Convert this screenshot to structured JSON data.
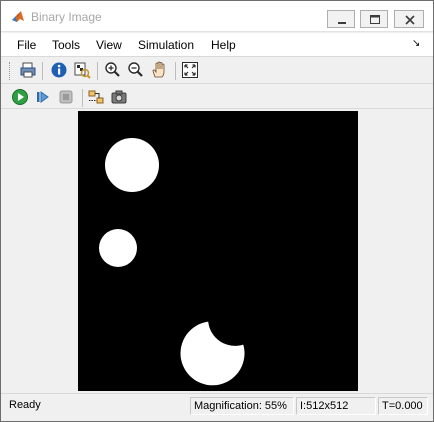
{
  "window": {
    "title": "Binary Image",
    "controls": {
      "minimize": "minimize",
      "maximize": "maximize",
      "close": "close"
    }
  },
  "menu": {
    "items": [
      "File",
      "Tools",
      "View",
      "Simulation",
      "Help"
    ]
  },
  "toolbar1": {
    "icons": [
      "print-icon",
      "info-icon",
      "pixel-region-icon",
      "zoom-in-icon",
      "zoom-out-icon",
      "pan-hand-icon",
      "fit-to-view-icon"
    ]
  },
  "toolbar2": {
    "icons": [
      "run-icon",
      "step-forward-icon",
      "stop-icon",
      "highlight-signals-icon",
      "snapshot-icon"
    ]
  },
  "image": {
    "background_color": "#000000",
    "foreground_color": "#ffffff",
    "size": "512x512"
  },
  "status": {
    "state": "Ready",
    "magnification": "Magnification: 55%",
    "image_size": "I:512x512",
    "time": "T=0.000"
  },
  "colors": {
    "run_green": "#2ea043",
    "info_blue": "#1f5fb4",
    "title_gray": "#a7a7a7"
  }
}
